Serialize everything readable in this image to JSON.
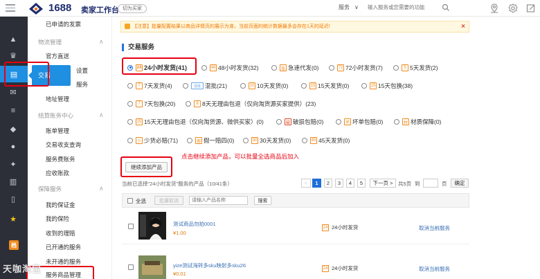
{
  "header": {
    "logo_text": "1688",
    "logo_sub": "卖家工作台",
    "switch_label": "切为买家",
    "service_dropdown": "服务",
    "search_placeholder": "输入服务或您需要的功能"
  },
  "sidebar": {
    "menu": [
      {
        "label": "已申请的发票",
        "type": "item"
      },
      {
        "label": "物流管理",
        "type": "header"
      },
      {
        "label": "官方直送",
        "type": "item"
      },
      {
        "label": "设置",
        "type": "item"
      },
      {
        "label": "服务",
        "type": "item"
      },
      {
        "label": "地址管理",
        "type": "item"
      },
      {
        "label": "结算账务中心",
        "type": "header"
      },
      {
        "label": "账单管理",
        "type": "item"
      },
      {
        "label": "交易收支查询",
        "type": "item"
      },
      {
        "label": "服务费账务",
        "type": "item"
      },
      {
        "label": "应收账款",
        "type": "item"
      },
      {
        "label": "保障服务",
        "type": "header"
      },
      {
        "label": "我的保证金",
        "type": "item"
      },
      {
        "label": "我的保险",
        "type": "item"
      },
      {
        "label": "收到的理赔",
        "type": "item"
      },
      {
        "label": "已开通的服务",
        "type": "item"
      },
      {
        "label": "未开通的服务",
        "type": "item"
      },
      {
        "label": "服务商品管理",
        "type": "item"
      }
    ],
    "popup_label": "交易"
  },
  "notice": {
    "text": "【注意】批量配置结果以商品详情页的展示为准，当前页面的统计数据最多会存在1天的延迟!"
  },
  "section": {
    "title": "交易服务"
  },
  "options": [
    {
      "label": "24小时发货(41)",
      "icon": "24",
      "selected": true
    },
    {
      "label": "48小时发货(32)",
      "icon": "48"
    },
    {
      "label": "急速代发(0)",
      "icon": "急"
    },
    {
      "label": "72小时发货(7)",
      "icon": "72"
    },
    {
      "label": "5天发货(2)",
      "icon": "5"
    },
    {
      "label": "7天发货(4)",
      "icon": "7"
    },
    {
      "label": "混批(21)",
      "icon": "混批"
    },
    {
      "label": "10天发货(0)",
      "icon": "10"
    },
    {
      "label": "15天发货(0)",
      "icon": "15"
    },
    {
      "label": "15天包换(38)",
      "icon": "15"
    },
    {
      "label": "7天包换(20)",
      "icon": "7"
    },
    {
      "label": "8天无理由包退（仅向淘货源买家提供）(23)",
      "icon": "8"
    },
    {
      "label": "15天无理由包退（仅向淘货源、微供买家）(0)",
      "icon": "15"
    },
    {
      "label": "破损包赔(0)",
      "icon": "破"
    },
    {
      "label": "坏单包赔(0)",
      "icon": "坏"
    },
    {
      "label": "材质保障(0)",
      "icon": "材"
    },
    {
      "label": "少货必赔(71)",
      "icon": "少"
    },
    {
      "label": "假一赔四(0)",
      "icon": "假"
    },
    {
      "label": "30天发货(0)",
      "icon": "30"
    },
    {
      "label": "45天发货(0)",
      "icon": "45"
    }
  ],
  "hint": "点击继续添加产品，可以批量全选商品后加入",
  "add_button": "继续添加产品",
  "selection_info": "当前已选择\"24小时发货\"服务的产品（10/41条）",
  "pager": {
    "prev": "<",
    "pages": [
      "1",
      "2",
      "3",
      "4",
      "5"
    ],
    "current": "1",
    "next": "下一页 >",
    "total": "共5页",
    "goto": "到",
    "unit": "页",
    "confirm": "确定"
  },
  "toolbar": {
    "select_all": "全选",
    "batch_cancel": "批量取消",
    "search_placeholder": "请输入产品名称",
    "search_button": "搜索"
  },
  "products": [
    {
      "name": "测试商品勿拍0001",
      "price": "¥1.00",
      "service": "24小时发货",
      "action": "取消当前服务"
    },
    {
      "name": "yize测试海转多sku映射多sku26",
      "price": "¥0.01",
      "service": "24小时发货",
      "action": "取消当前服务"
    }
  ],
  "watermark": "天咖淘宝"
}
